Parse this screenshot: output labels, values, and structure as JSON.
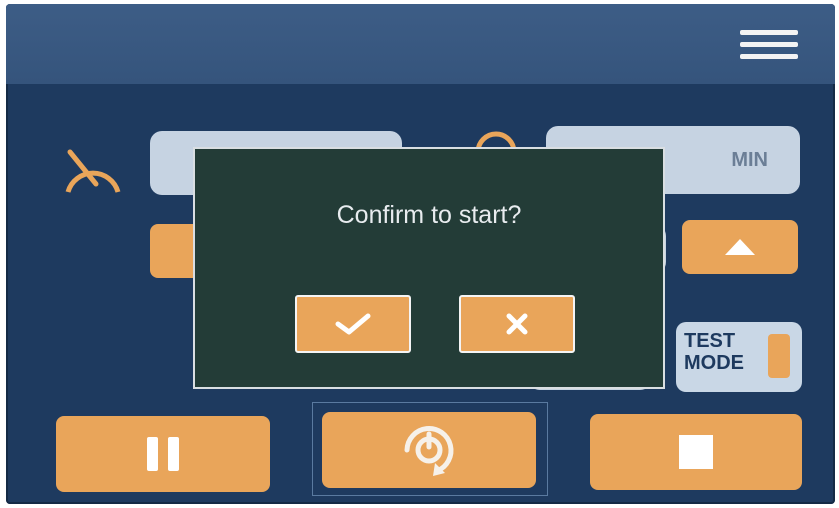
{
  "header": {
    "menu_icon": "hamburger-menu-icon"
  },
  "speed": {
    "icon": "speedometer-icon",
    "value": ""
  },
  "time": {
    "unit_label": "MIN",
    "icon": "clock-icon"
  },
  "test_mode": {
    "label": "TEST\nMODE"
  },
  "dialog": {
    "title": "Confirm to start?",
    "confirm_icon": "checkmark-icon",
    "cancel_icon": "x-icon"
  },
  "controls": {
    "pause_icon": "pause-icon",
    "start_icon": "power-cycle-icon",
    "stop_icon": "stop-icon"
  },
  "colors": {
    "background": "#1e3a5f",
    "header": "#3a5a82",
    "accent": "#e9a55a",
    "dialog": "#233c37",
    "field": "#c6d3e2"
  }
}
